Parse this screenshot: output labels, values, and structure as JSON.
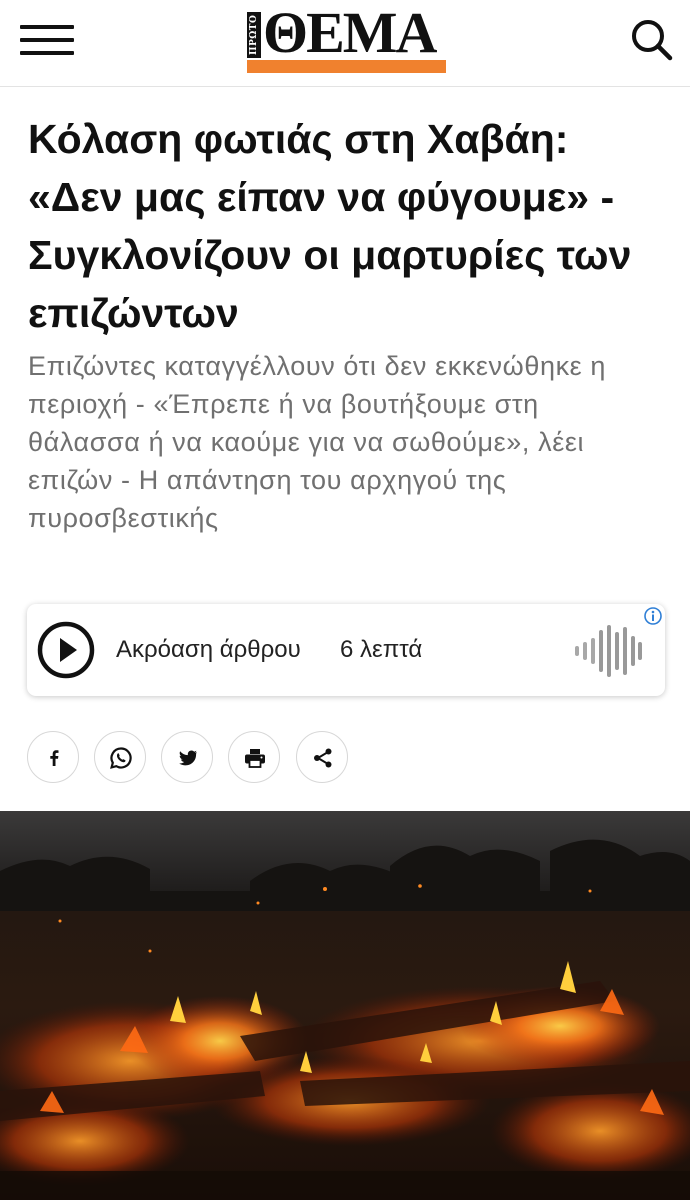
{
  "header": {
    "logo_prefix": "ΠΡΩΤΟ",
    "logo_text": "ΘΕΜΑ",
    "menu_icon": "hamburger-menu-icon",
    "search_icon": "search-icon",
    "brand_color": "#f0812e"
  },
  "article": {
    "headline": "Κόλαση φωτιάς στη Χαβάη: «Δεν μας είπαν να φύγουμε» - Συγκλονίζουν οι μαρτυρίες των επιζώντων",
    "subtitle": "Επιζώντες καταγγέλλουν ότι δεν εκκενώθηκε η περιοχή - «Έπρεπε ή να βουτήξουμε στη θάλασσα ή να καούμε για να σωθούμε», λέει επιζών - Η απάντηση του αρχηγού της πυροσβεστικής"
  },
  "audio": {
    "label": "Ακρόαση άρθρου",
    "duration": "6 λεπτά",
    "play_icon": "play-icon",
    "wave_icon": "sound-wave-icon",
    "info_icon": "info-icon"
  },
  "share": {
    "buttons": [
      "facebook-icon",
      "whatsapp-icon",
      "twitter-icon",
      "print-icon",
      "share-icon"
    ]
  },
  "hero_image": {
    "subject": "burning-logs-embers-photo"
  }
}
